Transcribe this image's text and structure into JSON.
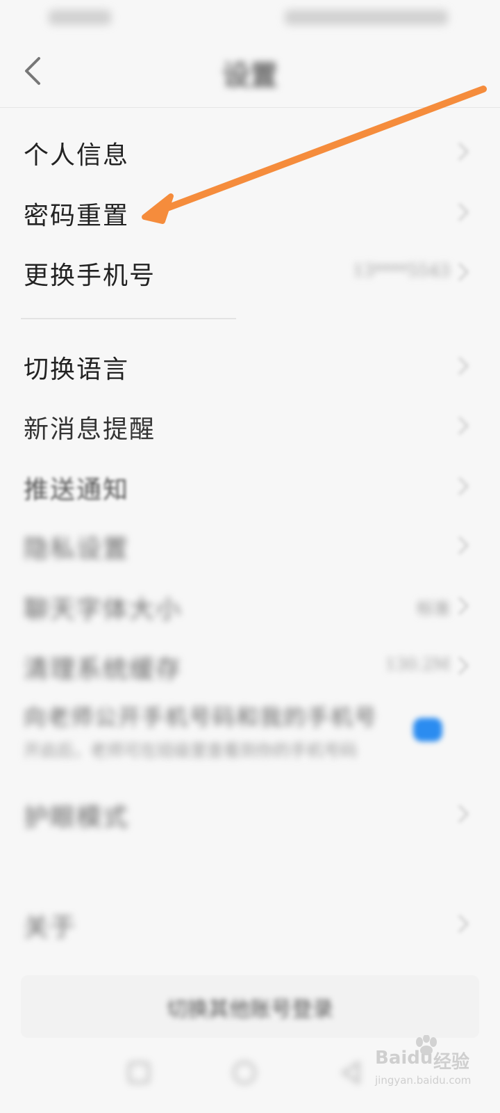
{
  "navbar": {
    "title": "设置"
  },
  "groups": [
    {
      "items": [
        {
          "label": "个人信息"
        },
        {
          "label": "密码重置"
        },
        {
          "label": "更换手机号",
          "value": "13****5543"
        }
      ]
    },
    {
      "items": [
        {
          "label": "切换语言"
        },
        {
          "label": "新消息提醒"
        },
        {
          "label": "推送通知"
        },
        {
          "label": "隐私设置"
        },
        {
          "label": "聊天字体大小",
          "value": "标准"
        },
        {
          "label": "清理系统缓存",
          "value": "130.2M"
        },
        {
          "label": "向老师公开手机号码和我的手机号",
          "description": "开启后，老师可在班级里查看到你的手机号码",
          "toggle_on": true
        },
        {
          "label": "护眼模式"
        },
        {
          "label": "关于"
        }
      ]
    }
  ],
  "bottom_button": {
    "label": "切换其他账号登录"
  },
  "watermark": {
    "brand": "Baidu",
    "product": "经验",
    "url": "jingyan.baidu.com"
  },
  "colors": {
    "arrow": "#f58c3c",
    "toggle": "#2b8cf0",
    "background": "#f7f7f7"
  },
  "icons": [
    "back-arrow-icon",
    "chevron-right-icon",
    "recent-apps-icon",
    "home-icon",
    "back-nav-icon"
  ]
}
